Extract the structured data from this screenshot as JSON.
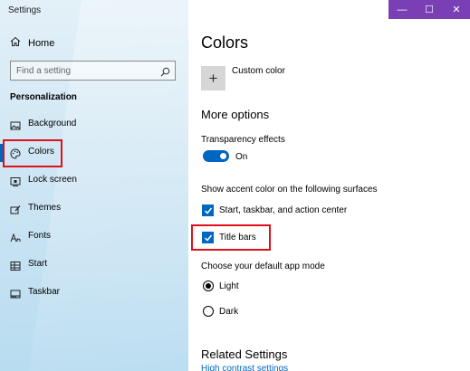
{
  "window": {
    "title": "Settings",
    "accent_color": "#7a3fb5"
  },
  "window_controls": {
    "minimize": "—",
    "maximize": "☐",
    "close": "✕"
  },
  "sidebar": {
    "home_label": "Home",
    "search_placeholder": "Find a setting",
    "section_title": "Personalization",
    "items": [
      {
        "label": "Background",
        "icon": "image-icon"
      },
      {
        "label": "Colors",
        "icon": "palette-icon",
        "selected": true
      },
      {
        "label": "Lock screen",
        "icon": "lock-screen-icon"
      },
      {
        "label": "Themes",
        "icon": "themes-brush-icon"
      },
      {
        "label": "Fonts",
        "icon": "fonts-icon"
      },
      {
        "label": "Start",
        "icon": "start-grid-icon"
      },
      {
        "label": "Taskbar",
        "icon": "taskbar-icon"
      }
    ]
  },
  "main": {
    "title": "Colors",
    "custom_color_symbol": "+",
    "custom_color_label": "Custom color",
    "more_options_heading": "More options",
    "transparency_label": "Transparency effects",
    "transparency_state": "On",
    "accent_surfaces_label": "Show accent color on the following surfaces",
    "checkbox_start_taskbar": {
      "label": "Start, taskbar, and action center",
      "checked": true
    },
    "checkbox_title_bars": {
      "label": "Title bars",
      "checked": true
    },
    "app_mode_label": "Choose your default app mode",
    "app_mode_options": [
      {
        "label": "Light",
        "selected": true
      },
      {
        "label": "Dark",
        "selected": false
      }
    ],
    "related_heading": "Related Settings",
    "related_link_partial": "High contrast settings"
  },
  "colors": {
    "accent_blue": "#0067c0",
    "highlight_red": "#e0101a"
  }
}
